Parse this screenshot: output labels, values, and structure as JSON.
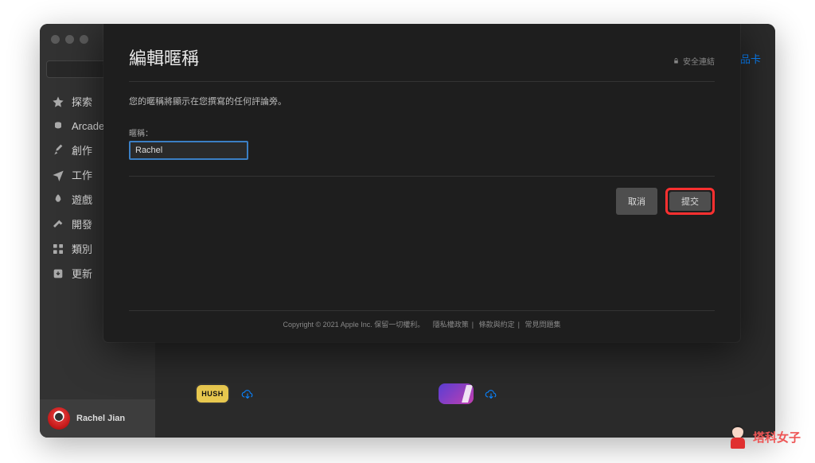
{
  "sidebar": {
    "items": [
      {
        "label": "探索"
      },
      {
        "label": "Arcade"
      },
      {
        "label": "創作"
      },
      {
        "label": "工作"
      },
      {
        "label": "遊戲"
      },
      {
        "label": "開發"
      },
      {
        "label": "類別"
      },
      {
        "label": "更新"
      }
    ],
    "user_name": "Rachel Jian"
  },
  "header": {
    "gift_link": "禮品卡"
  },
  "apps": {
    "hush_label": "HUSH"
  },
  "modal": {
    "title": "編輯暱稱",
    "secure_label": "安全連結",
    "description": "您的暱稱將顯示在您撰寫的任何評論旁。",
    "field_label": "暱稱：",
    "nickname_value": "Rachel",
    "cancel": "取消",
    "submit": "提交",
    "footer": {
      "copyright": "Copyright © 2021 Apple Inc. 保留一切權利。",
      "privacy": "隱私權政策",
      "terms": "條款與約定",
      "faq": "常見問題集"
    }
  },
  "watermark": "塔科女子"
}
